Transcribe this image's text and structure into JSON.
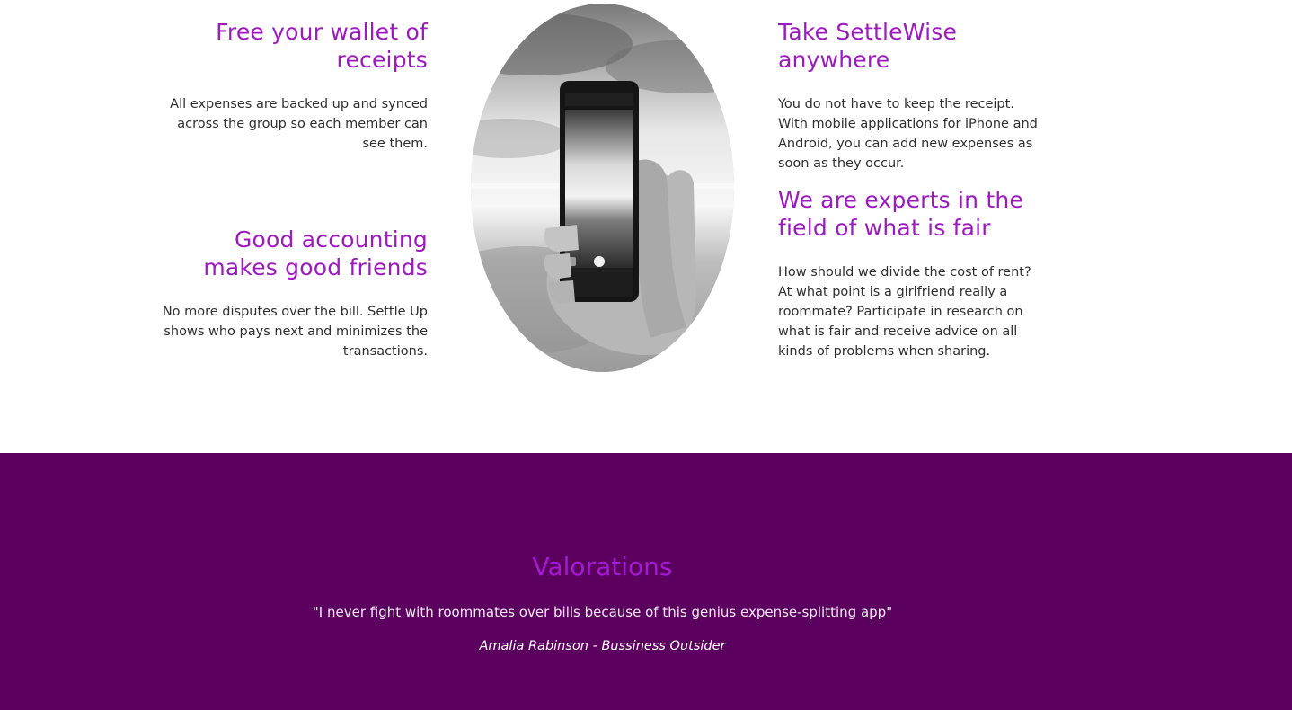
{
  "features": {
    "left": [
      {
        "title": "Free your wallet of receipts",
        "text": "All expenses are backed up and synced across the group so each member can see them."
      },
      {
        "title": "Good accounting makes good friends",
        "text": "No more disputes over the bill. Settle Up shows who pays next and minimizes the transactions."
      }
    ],
    "right": [
      {
        "title": "Take SettleWise anywhere",
        "text": "You do not have to keep the receipt. With mobile applications for iPhone and Android, you can add new expenses as soon as they occur."
      },
      {
        "title": "We are experts in the field of what is fair",
        "text": "How should we divide the cost of rent? At what point is a girlfriend really a roommate? Participate in research on what is fair and receive advice on all kinds of problems when sharing."
      }
    ]
  },
  "valorations": {
    "title": "Valorations",
    "quote": "\"I never fight with roommates over bills because of this genius expense-splitting app\"",
    "author": "Amalia Rabinson",
    "separator": " - ",
    "source": "Bussiness Outsider"
  },
  "colors": {
    "heading": "#9b1bbd",
    "band_background": "#5c0060",
    "band_heading": "#a51ad1"
  }
}
